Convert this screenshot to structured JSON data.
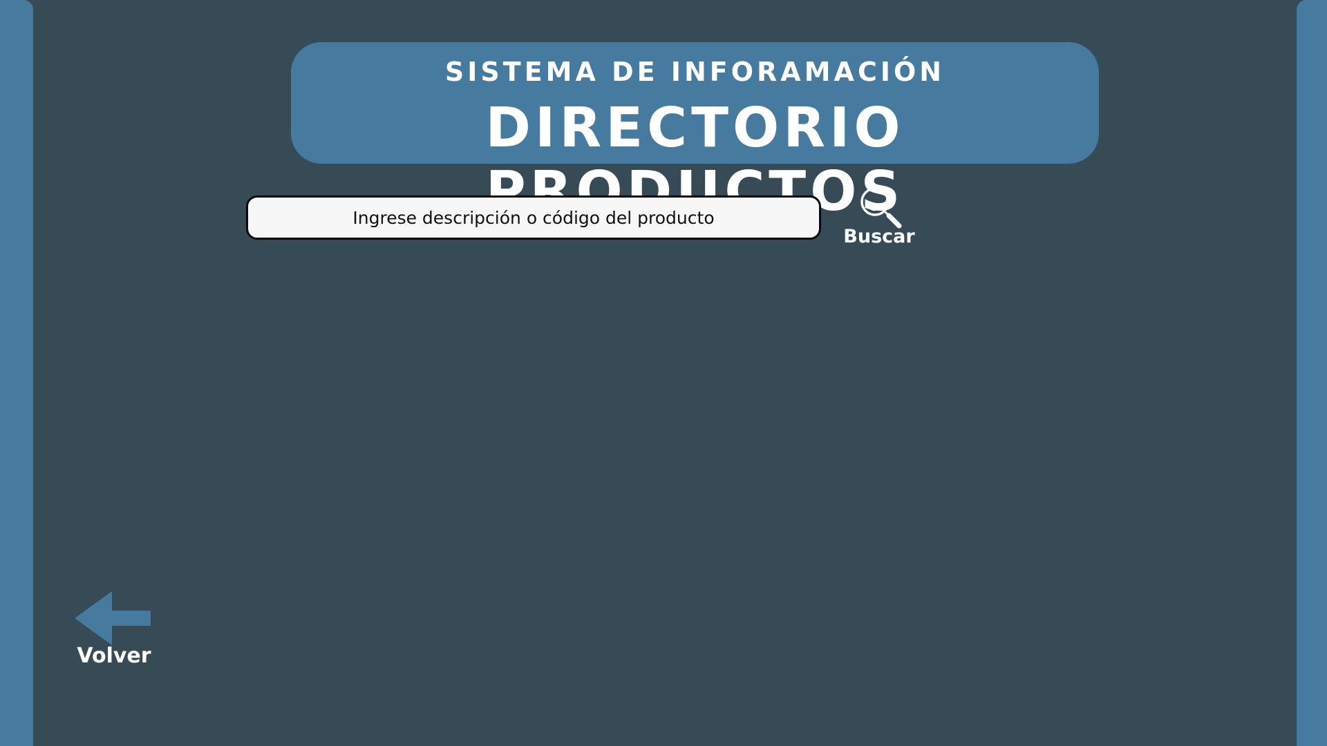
{
  "header": {
    "subtitle": "SISTEMA DE INFORAMACIÓN",
    "title": "DIRECTORIO PRODUCTOS"
  },
  "search": {
    "placeholder": "Ingrese descripción o código del producto",
    "value": "",
    "button_label": "Buscar",
    "button_icon": "magnifier-icon"
  },
  "back": {
    "label": "Volver",
    "icon": "arrow-left-icon"
  },
  "colors": {
    "background": "#374b57",
    "accent": "#467b9f",
    "text_light": "#ffffff",
    "input_background": "#f8f7f7",
    "input_border": "#0c0c0c"
  }
}
